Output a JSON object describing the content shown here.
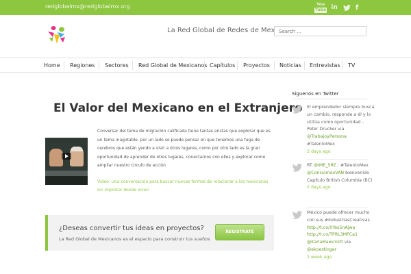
{
  "topbar": {
    "email": "redglobalmx@redglobalmx.org",
    "social": [
      "youtube-icon",
      "linkedin-icon",
      "twitter-icon",
      "facebook-icon"
    ],
    "youtube_you": "You",
    "youtube_tube": "Tube",
    "linkedin_glyph": "in",
    "twitter_glyph": "🐦",
    "facebook_glyph": "f"
  },
  "header": {
    "tagline": "La Red Global de Redes de Mexicanos",
    "search_placeholder": "Search ..."
  },
  "nav": {
    "items": [
      "Home",
      "Regiones",
      "Sectores",
      "Red Global de Mexicanos",
      "Capítulos",
      "Proyectos",
      "Noticias",
      "Entrevistas",
      "TV"
    ]
  },
  "article": {
    "title": "El Valor del Mexicano en el Extranjero",
    "body": "Conversar del tema de migración calificada tiene tantas aristas que explorar que es un tema inagotable, por un lado se puede pensar en que tenemos una fuga de cerebros que están yendo a vivir a otros lugares, como por otro lado es la gran oportunidad de aprender de otros lugares, conectarnos con ellos y explorar como ampliar nuestro circulo de acción",
    "video_link": "Video: Una conversación para buscar nuevas formas de relacionar a los mexicanos sin importar donde viven"
  },
  "cta": {
    "title": "¿Deseas convertir tus ideas en proyectos?",
    "subtitle": "La Red Global de Mexicanos es el espacio para construir tus sueños",
    "button": "REGISTRATE"
  },
  "sidebar": {
    "title": "Siguenos en Twitter",
    "tweets": [
      {
        "text": "El emprendedor siempre busca un cambio, responde a él y lo utiliza como oportunidad - Peter Drucker via",
        "link": "@TrabajoyPersona",
        "tail": "#TalentoMex",
        "time": "2 days ago"
      },
      {
        "text": "RT",
        "link": "@IME_SRE",
        "tail": ": #TalentoMex",
        "link2": "@ConsulmexVAN",
        "tail2": "bienvenido Capítulo British Columbia (BC)",
        "time": "2 days ago"
      },
      {
        "text": "México puede ofrecer mucho con sus #IndustriasCreativas",
        "link": "http://t.co/0Yas5nAjwa",
        "link2": "http://t.co/TPRL3MFCa1",
        "link3": "@KarlaMawcinitt",
        "tail": "via",
        "link4": "@ekoestinger",
        "time": "1 week ago"
      }
    ]
  },
  "colors": {
    "accent": "#8dc63f",
    "topbar": "#8dc63f",
    "cta_background": "#f2f2f2"
  }
}
